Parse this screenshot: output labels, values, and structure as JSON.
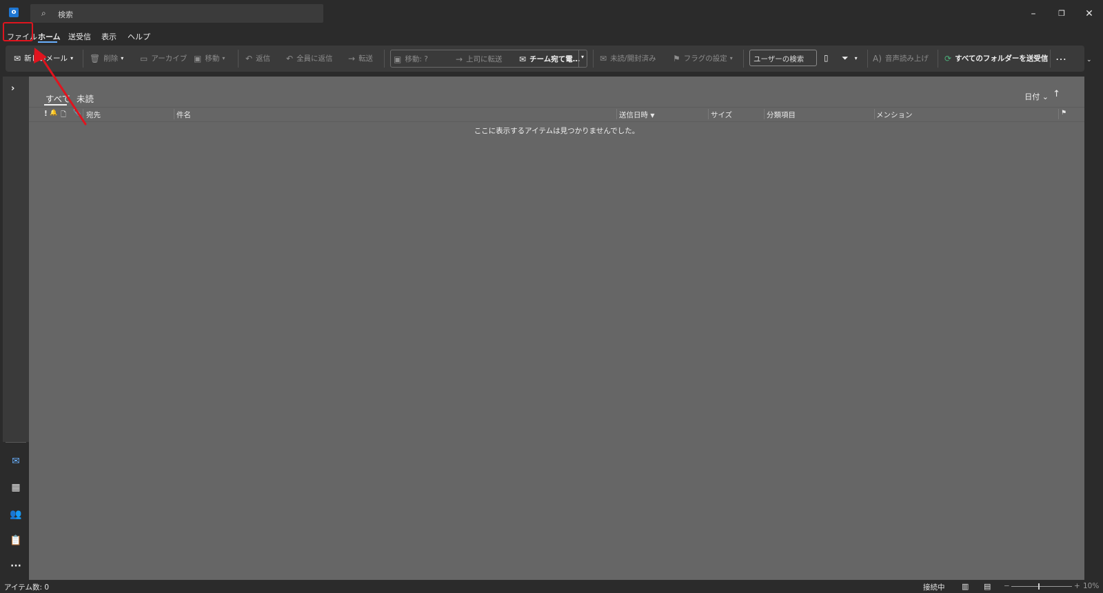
{
  "titlebar": {
    "app_icon_letter": "o",
    "search_placeholder": "検索",
    "minimize": "–",
    "restore": "❐",
    "close": "✕"
  },
  "menu": {
    "tabs": [
      "ファイル",
      "ホーム",
      "送受信",
      "表示",
      "ヘルプ"
    ],
    "active_tab": "ホーム",
    "highlighted_tab": "ファイル"
  },
  "ribbon": {
    "new_mail": "新しいメール",
    "delete": "削除",
    "archive": "アーカイブ",
    "move": "移動",
    "reply": "返信",
    "reply_all": "全員に返信",
    "forward": "転送",
    "quick_move": "移動: ?",
    "to_manager": "上司に転送",
    "team_email": "チーム宛て電…",
    "unread_read": "未読/開封済み",
    "flag": "フラグの設定",
    "user_search_placeholder": "ユーザーの検索",
    "read_aloud": "音声読み上げ",
    "send_receive_all": "すべてのフォルダーを送受信",
    "more": "…"
  },
  "list": {
    "filter_all": "すべて",
    "filter_unread": "未読",
    "sort_by": "日付",
    "columns": {
      "importance": "!",
      "reminder": "🔔",
      "icon": "🗋",
      "attachment": "📎",
      "to": "宛先",
      "subject": "件名",
      "sent": "送信日時",
      "size": "サイズ",
      "categories": "分類項目",
      "mention": "メンション"
    },
    "empty_message": "ここに表示するアイテムは見つかりませんでした。"
  },
  "status": {
    "item_count": "アイテム数: 0",
    "connection": "接続中",
    "zoom": "10%"
  },
  "colors": {
    "accent": "#6ab1ff",
    "highlight_box": "#e0141e",
    "annotation_arrow": "#e0141e",
    "pane_bg": "#666666",
    "ribbon_bg": "#3a3a3a"
  }
}
